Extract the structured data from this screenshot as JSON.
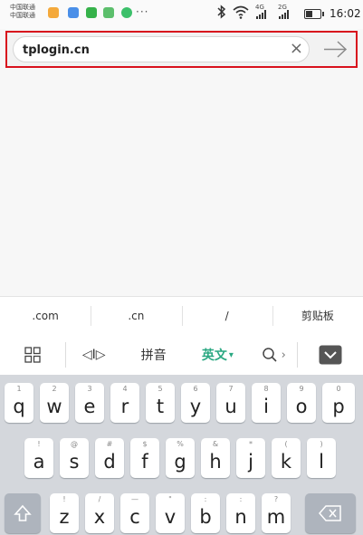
{
  "status_bar": {
    "carrier_line1": "中国联通",
    "carrier_line2": "中国联通",
    "more": "···",
    "net1": "4G",
    "net2": "2G",
    "time": "16:02"
  },
  "address_bar": {
    "url": "tplogin.cn",
    "clear_symbol": "×"
  },
  "suggestions": [
    ".com",
    ".cn",
    "/",
    "剪贴板"
  ],
  "toolbar": {
    "cursor_label": "◁I▷",
    "pinyin": "拼音",
    "english": "英文",
    "english_caret": "▾",
    "search_chevron": "›"
  },
  "keyboard": {
    "row1": [
      {
        "main": "q",
        "sub": "1"
      },
      {
        "main": "w",
        "sub": "2"
      },
      {
        "main": "e",
        "sub": "3"
      },
      {
        "main": "r",
        "sub": "4"
      },
      {
        "main": "t",
        "sub": "5"
      },
      {
        "main": "y",
        "sub": "6"
      },
      {
        "main": "u",
        "sub": "7"
      },
      {
        "main": "i",
        "sub": "8"
      },
      {
        "main": "o",
        "sub": "9"
      },
      {
        "main": "p",
        "sub": "0"
      }
    ],
    "row2": [
      {
        "main": "a",
        "sub": "!"
      },
      {
        "main": "s",
        "sub": "@"
      },
      {
        "main": "d",
        "sub": "#"
      },
      {
        "main": "f",
        "sub": "$"
      },
      {
        "main": "g",
        "sub": "%"
      },
      {
        "main": "h",
        "sub": "&"
      },
      {
        "main": "j",
        "sub": "*"
      },
      {
        "main": "k",
        "sub": "("
      },
      {
        "main": "l",
        "sub": ")"
      }
    ],
    "row3": [
      {
        "main": "z",
        "sub": "!"
      },
      {
        "main": "x",
        "sub": "/"
      },
      {
        "main": "c",
        "sub": "—"
      },
      {
        "main": "v",
        "sub": "\""
      },
      {
        "main": "b",
        "sub": ":"
      },
      {
        "main": "n",
        "sub": ":"
      },
      {
        "main": "m",
        "sub": "?"
      }
    ]
  },
  "colors": {
    "highlight_border": "#d8121d",
    "accent_green": "#2aa882",
    "keyboard_bg": "#d4d7dc"
  }
}
